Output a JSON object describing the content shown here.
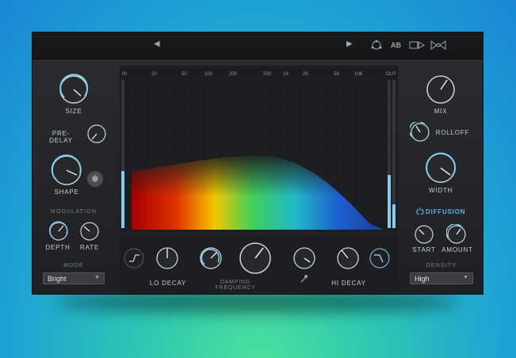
{
  "header": {
    "prev_icon": "◀",
    "next_icon": "▶",
    "ab_label": "AB"
  },
  "left": {
    "size": "SIZE",
    "predelay": "PRE-DELAY",
    "shape": "SHAPE",
    "modulation": "MODULATION",
    "depth": "DEPTH",
    "rate": "RATE",
    "mode": "MODE",
    "mode_value": "Bright"
  },
  "center": {
    "freq_in": "IN",
    "freq_out": "OUT",
    "freqs": [
      "20",
      "50",
      "100",
      "200",
      "500",
      "1K",
      "2K",
      "5K",
      "10K"
    ],
    "lo_decay": "LO DECAY",
    "hi_decay": "HI DECAY",
    "mid": "DAMPING FREQUENCY"
  },
  "right": {
    "mix": "MIX",
    "rolloff": "ROLLOFF",
    "width": "WIDTH",
    "diffusion": "DIFFUSION",
    "start": "START",
    "amount": "AMOUNT",
    "density": "DENSITY",
    "density_value": "High"
  },
  "colors": {
    "accent": "#7fcdf2",
    "diffusion": "#4fb6e8"
  }
}
